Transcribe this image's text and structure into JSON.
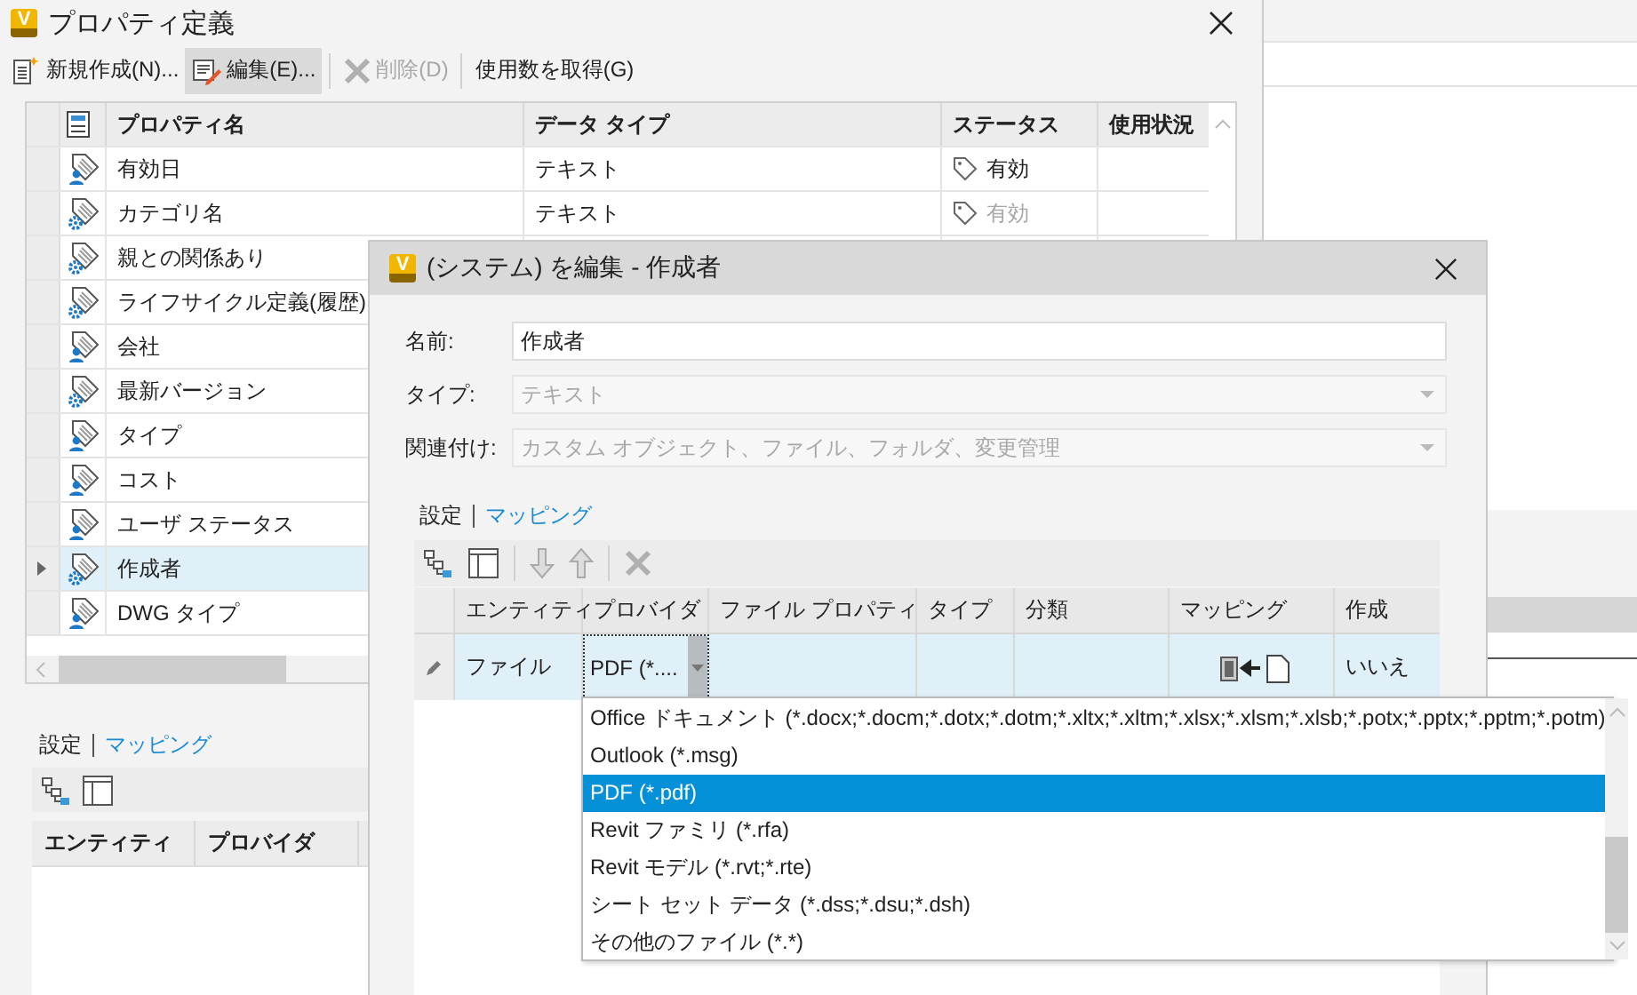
{
  "main_window": {
    "logo": "V",
    "title": "プロパティ定義",
    "toolbar": [
      {
        "kind": "new",
        "label": "新規作成(N)...",
        "disabled": false,
        "active": false
      },
      {
        "kind": "edit",
        "label": "編集(E)...",
        "disabled": false,
        "active": true
      },
      {
        "kind": "delete",
        "label": "削除(D)",
        "disabled": true,
        "active": false
      },
      {
        "kind": "text",
        "label": "使用数を取得(G)",
        "disabled": false,
        "active": false
      }
    ],
    "table": {
      "columns": [
        "プロパティ名",
        "データ タイプ",
        "ステータス",
        "使用状況"
      ],
      "rows": [
        {
          "kind": "user",
          "name": "有効日",
          "data_type": "テキスト",
          "status": "有効",
          "status_disabled": false,
          "selected": false
        },
        {
          "kind": "system",
          "name": "カテゴリ名",
          "data_type": "テキスト",
          "status": "有効",
          "status_disabled": true,
          "selected": false
        },
        {
          "kind": "system",
          "name": "親との関係あり",
          "selected": false
        },
        {
          "kind": "system",
          "name": "ライフサイクル定義(履歴)",
          "selected": false
        },
        {
          "kind": "user",
          "name": "会社",
          "selected": false
        },
        {
          "kind": "system",
          "name": "最新バージョン",
          "selected": false
        },
        {
          "kind": "user",
          "name": "タイプ",
          "selected": false
        },
        {
          "kind": "user",
          "name": "コスト",
          "selected": false
        },
        {
          "kind": "user",
          "name": "ユーザ ステータス",
          "selected": false
        },
        {
          "kind": "system",
          "name": "作成者",
          "selected": true
        },
        {
          "kind": "user",
          "name": "DWG タイプ",
          "selected": false
        }
      ]
    },
    "tabs": [
      {
        "label": "設定",
        "selected": false
      },
      {
        "label": "マッピング",
        "selected": true
      }
    ],
    "grid": {
      "columns": [
        "エンティティ",
        "プロバイダ"
      ]
    }
  },
  "dialog": {
    "logo": "V",
    "title": "(システム) を編集 - 作成者",
    "fields": [
      {
        "kind": "text",
        "label": "名前:",
        "value": "作成者",
        "disabled": false
      },
      {
        "kind": "combo",
        "label": "タイプ:",
        "value": "テキスト",
        "disabled": true
      },
      {
        "kind": "combo",
        "label": "関連付け:",
        "value": "カスタム オブジェクト、ファイル、フォルダ、変更管理",
        "disabled": true
      }
    ],
    "tabs": [
      {
        "label": "設定",
        "selected": false
      },
      {
        "label": "マッピング",
        "selected": true
      }
    ],
    "toolbar": [
      {
        "kind": "tree",
        "disabled": false
      },
      {
        "kind": "columns",
        "disabled": false
      },
      {
        "kind": "down",
        "disabled": true
      },
      {
        "kind": "up",
        "disabled": true
      },
      {
        "kind": "delete",
        "disabled": true
      }
    ],
    "grid": {
      "columns": [
        "エンティティ",
        "プロバイダ",
        "ファイル プロパティ",
        "タイプ",
        "分類",
        "マッピング",
        "作成"
      ],
      "rows": [
        {
          "entity": "ファイル",
          "provider": "PDF (*....",
          "create": "いいえ",
          "selected": true
        }
      ]
    }
  },
  "dropdown": {
    "items": [
      {
        "label": "Office ドキュメント (*.docx;*.docm;*.dotx;*.dotm;*.xltx;*.xltm;*.xlsx;*.xlsm;*.xlsb;*.potx;*.pptx;*.pptm;*.potm)",
        "selected": false
      },
      {
        "label": "Outlook (*.msg)",
        "selected": false
      },
      {
        "label": "PDF (*.pdf)",
        "selected": true
      },
      {
        "label": "Revit ファミリ (*.rfa)",
        "selected": false
      },
      {
        "label": "Revit モデル (*.rvt;*.rte)",
        "selected": false
      },
      {
        "label": "シート セット データ (*.dss;*.dsu;*.dsh)",
        "selected": false
      },
      {
        "label": "その他のファイル (*.*)",
        "selected": false
      }
    ]
  }
}
